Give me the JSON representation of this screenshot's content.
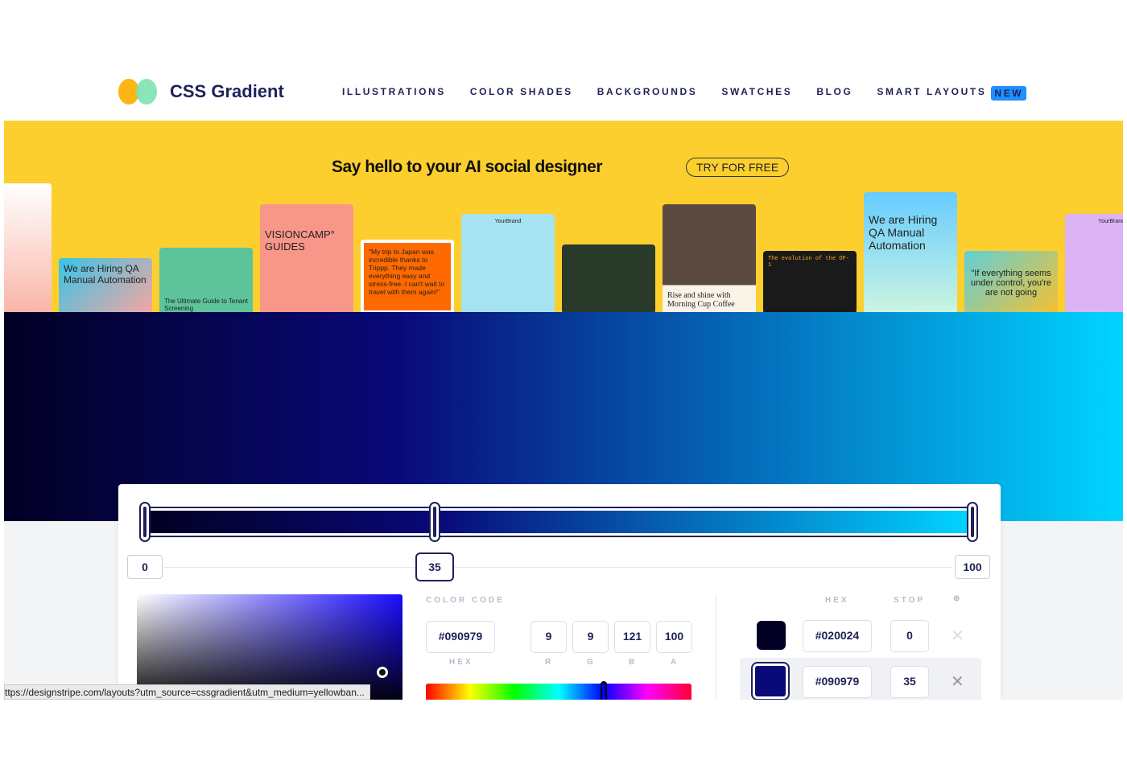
{
  "header": {
    "brand": "CSS Gradient",
    "nav": [
      "ILLUSTRATIONS",
      "COLOR SHADES",
      "BACKGROUNDS",
      "SWATCHES",
      "BLOG",
      "SMART LAYOUTS"
    ],
    "new_badge": "NEW"
  },
  "banner": {
    "title": "Say hello to your AI social designer",
    "cta": "TRY FOR FREE",
    "cards": [
      "We are Hiring QA Manual Automation",
      "The Ultimate Guide to Tenant Screening",
      "VISIONCAMP° GUIDES",
      "\"My trip to Japan was incredible thanks to Trippp. They made everything easy and stress-free. I can't wait to travel with them again!\"",
      "YourBrand",
      "Rise and shine with Morning Cup Coffee",
      "The evolution of the OP-1",
      "We are Hiring QA Manual Automation",
      "\"If everything seems under control, you're are not going",
      "YourBrand"
    ]
  },
  "gradient": {
    "stops": [
      {
        "hex": "#020024",
        "stop": 0
      },
      {
        "hex": "#090979",
        "stop": 35
      },
      {
        "hex": "#00d4ff",
        "stop": 100
      }
    ]
  },
  "slider": {
    "labels": [
      "0",
      "35",
      "100"
    ]
  },
  "color_code": {
    "title": "COLOR CODE",
    "hex": "#090979",
    "r": "9",
    "g": "9",
    "b": "121",
    "a": "100",
    "hex_label": "HEX",
    "r_label": "R",
    "g_label": "G",
    "b_label": "B",
    "a_label": "A"
  },
  "stops_table": {
    "hex_header": "HEX",
    "stop_header": "STOP",
    "add_icon": "⊕",
    "rows": [
      {
        "hex": "#020024",
        "stop": "0"
      },
      {
        "hex": "#090979",
        "stop": "35"
      }
    ]
  },
  "status_url": "ttps://designstripe.com/layouts?utm_source=cssgradient&utm_medium=yellowban..."
}
